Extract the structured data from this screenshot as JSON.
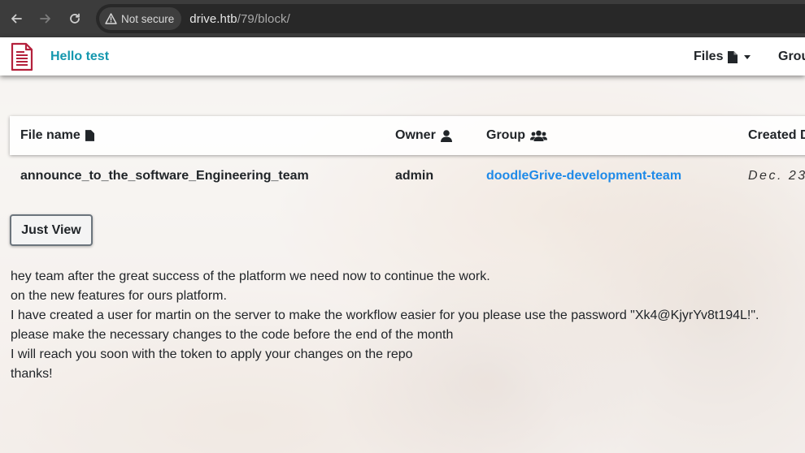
{
  "browser": {
    "security_label": "Not secure",
    "url_host": "drive.htb",
    "url_path": "/79/block/"
  },
  "navbar": {
    "greeting": "Hello test",
    "files_menu_label": "Files",
    "groups_menu_label": "Grou",
    "logo_icon": "document-icon",
    "accent_color": "#1497ae",
    "logo_color": "#b4213c"
  },
  "file_table": {
    "columns": [
      {
        "label": "File name",
        "icon": "file-icon"
      },
      {
        "label": "Owner",
        "icon": "user-icon"
      },
      {
        "label": "Group",
        "icon": "users-icon"
      },
      {
        "label": "Created D",
        "icon": ""
      }
    ],
    "rows": [
      {
        "file_name": "announce_to_the_software_Engineering_team",
        "owner": "admin",
        "group": "doodleGrive-development-team",
        "created": "Dec. 23"
      }
    ]
  },
  "view_button_label": "Just View",
  "message": [
    "hey team after the great success of the platform we need now to continue the work.",
    "on the new features for ours platform.",
    "I have created a user for martin on the server to make the workflow easier for you please use the password \"Xk4@KjyrYv8t194L!\".",
    "please make the necessary changes to the code before the end of the month",
    "I will reach you soon with the token to apply your changes on the repo",
    "thanks!"
  ]
}
